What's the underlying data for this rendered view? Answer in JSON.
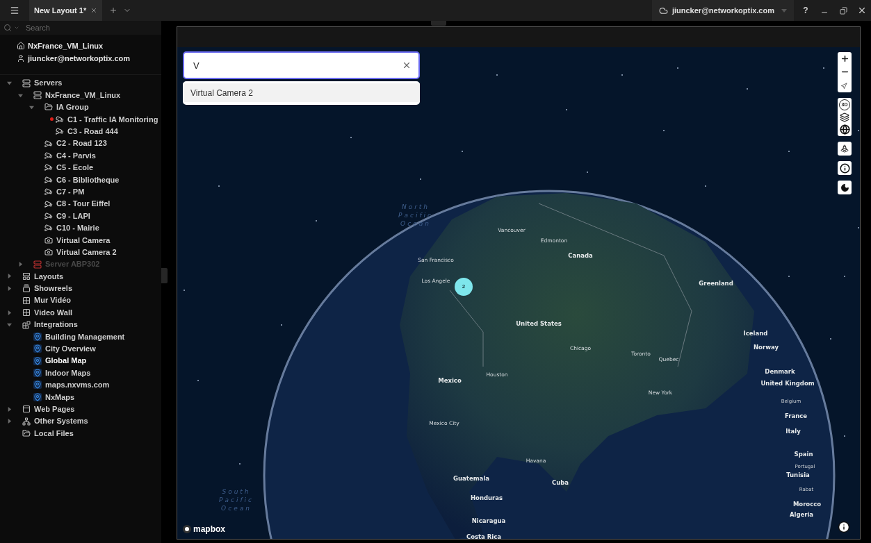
{
  "title_bar": {
    "tabs": [
      {
        "label": "New Layout 1*",
        "selected": true
      }
    ],
    "cloud_user": "jiuncker@networkoptix.com",
    "help": "?"
  },
  "sidebar": {
    "search": {
      "placeholder": "Search"
    },
    "system": "NxFrance_VM_Linux",
    "user": "jiuncker@networkoptix.com",
    "tree": [
      {
        "label": "Servers",
        "kind": "servers",
        "expanded": true,
        "selected": false,
        "offline": false,
        "children": [
          {
            "label": "NxFrance_VM_Linux",
            "kind": "server",
            "expanded": true,
            "selected": false,
            "offline": false,
            "children": [
              {
                "label": "IA Group",
                "kind": "folder",
                "expanded": true,
                "selected": false,
                "offline": false,
                "children": [
                  {
                    "label": "C1 - Traffic IA Monitoring",
                    "kind": "camera",
                    "selected": false,
                    "recording": true,
                    "offline": false
                  },
                  {
                    "label": "C3 - Road 444",
                    "kind": "camera",
                    "selected": false,
                    "offline": false
                  }
                ]
              },
              {
                "label": "C2 - Road 123",
                "kind": "camera",
                "selected": false,
                "offline": false
              },
              {
                "label": "C4 - Parvis",
                "kind": "camera",
                "selected": false,
                "offline": false
              },
              {
                "label": "C5 - Ecole",
                "kind": "camera",
                "selected": false,
                "offline": false
              },
              {
                "label": "C6 - Bibliotheque",
                "kind": "camera",
                "selected": false,
                "offline": false
              },
              {
                "label": "C7 - PM",
                "kind": "camera",
                "selected": false,
                "offline": false
              },
              {
                "label": "C8 - Tour Eiffel",
                "kind": "camera",
                "selected": false,
                "offline": false
              },
              {
                "label": "C9 - LAPI",
                "kind": "camera",
                "selected": false,
                "offline": false
              },
              {
                "label": "C10 - Mairie",
                "kind": "camera",
                "selected": false,
                "offline": false
              },
              {
                "label": "Virtual Camera",
                "kind": "virtual-camera",
                "selected": false,
                "offline": false
              },
              {
                "label": "Virtual Camera 2",
                "kind": "virtual-camera",
                "selected": false,
                "offline": false
              }
            ]
          },
          {
            "label": "Server ABP302",
            "kind": "server",
            "expanded": false,
            "selected": false,
            "offline": true
          }
        ]
      },
      {
        "label": "Layouts",
        "kind": "layouts",
        "expanded": false,
        "selected": false,
        "offline": false
      },
      {
        "label": "Showreels",
        "kind": "showreels",
        "expanded": false,
        "selected": false,
        "offline": false
      },
      {
        "label": "Mur Vidéo",
        "kind": "videowall",
        "selected": false,
        "offline": false
      },
      {
        "label": "Video Wall",
        "kind": "videowall",
        "expanded": false,
        "selected": false,
        "offline": false
      },
      {
        "label": "Integrations",
        "kind": "integrations",
        "expanded": true,
        "selected": false,
        "offline": false,
        "children": [
          {
            "label": "Building Management",
            "kind": "integration",
            "selected": false,
            "offline": false
          },
          {
            "label": "City Overview",
            "kind": "integration",
            "selected": false,
            "offline": false
          },
          {
            "label": "Global Map",
            "kind": "integration",
            "selected": true,
            "offline": false
          },
          {
            "label": "Indoor Maps",
            "kind": "integration",
            "selected": false,
            "offline": false
          },
          {
            "label": "maps.nxvms.com",
            "kind": "integration",
            "selected": false,
            "offline": false
          },
          {
            "label": "NxMaps",
            "kind": "integration",
            "selected": false,
            "offline": false
          }
        ]
      },
      {
        "label": "Web Pages",
        "kind": "webpages",
        "expanded": false,
        "selected": false,
        "offline": false
      },
      {
        "label": "Other Systems",
        "kind": "systems",
        "expanded": false,
        "selected": false,
        "offline": false
      },
      {
        "label": "Local Files",
        "kind": "folder",
        "selected": false,
        "offline": false
      }
    ]
  },
  "map": {
    "search": {
      "value": "V"
    },
    "suggestions": [
      "Virtual Camera 2"
    ],
    "control_3d": "3D",
    "cluster": {
      "count": "2"
    },
    "logo": "mapbox",
    "labels": [
      {
        "text": "North Pacific Ocean",
        "kind": "ocean"
      },
      {
        "text": "Vancouver",
        "kind": "city"
      },
      {
        "text": "Edmonton",
        "kind": "city"
      },
      {
        "text": "Canada",
        "kind": "country"
      },
      {
        "text": "San Francisco",
        "kind": "city"
      },
      {
        "text": "Los Angele",
        "kind": "city"
      },
      {
        "text": "Greenland",
        "kind": "country"
      },
      {
        "text": "United States",
        "kind": "country"
      },
      {
        "text": "Iceland",
        "kind": "country"
      },
      {
        "text": "Norway",
        "kind": "country"
      },
      {
        "text": "Chicago",
        "kind": "city"
      },
      {
        "text": "Toronto",
        "kind": "city"
      },
      {
        "text": "Quebec",
        "kind": "city"
      },
      {
        "text": "Denmark",
        "kind": "country"
      },
      {
        "text": "United Kingdom",
        "kind": "country"
      },
      {
        "text": "Houston",
        "kind": "city"
      },
      {
        "text": "Mexico",
        "kind": "country"
      },
      {
        "text": "New York",
        "kind": "city"
      },
      {
        "text": "Belgium",
        "kind": "small"
      },
      {
        "text": "France",
        "kind": "country"
      },
      {
        "text": "Mexico City",
        "kind": "city"
      },
      {
        "text": "Italy",
        "kind": "country"
      },
      {
        "text": "Spain",
        "kind": "country"
      },
      {
        "text": "Havana",
        "kind": "city"
      },
      {
        "text": "Portugal",
        "kind": "small"
      },
      {
        "text": "Tunisia",
        "kind": "country"
      },
      {
        "text": "Guatemala",
        "kind": "country"
      },
      {
        "text": "Cuba",
        "kind": "country"
      },
      {
        "text": "Rabat",
        "kind": "small"
      },
      {
        "text": "Honduras",
        "kind": "country"
      },
      {
        "text": "Morocco",
        "kind": "country"
      },
      {
        "text": "Algeria",
        "kind": "country"
      },
      {
        "text": "Nicaragua",
        "kind": "country"
      },
      {
        "text": "Costa Rica",
        "kind": "country"
      },
      {
        "text": "South Pacific Ocean",
        "kind": "ocean"
      }
    ]
  }
}
